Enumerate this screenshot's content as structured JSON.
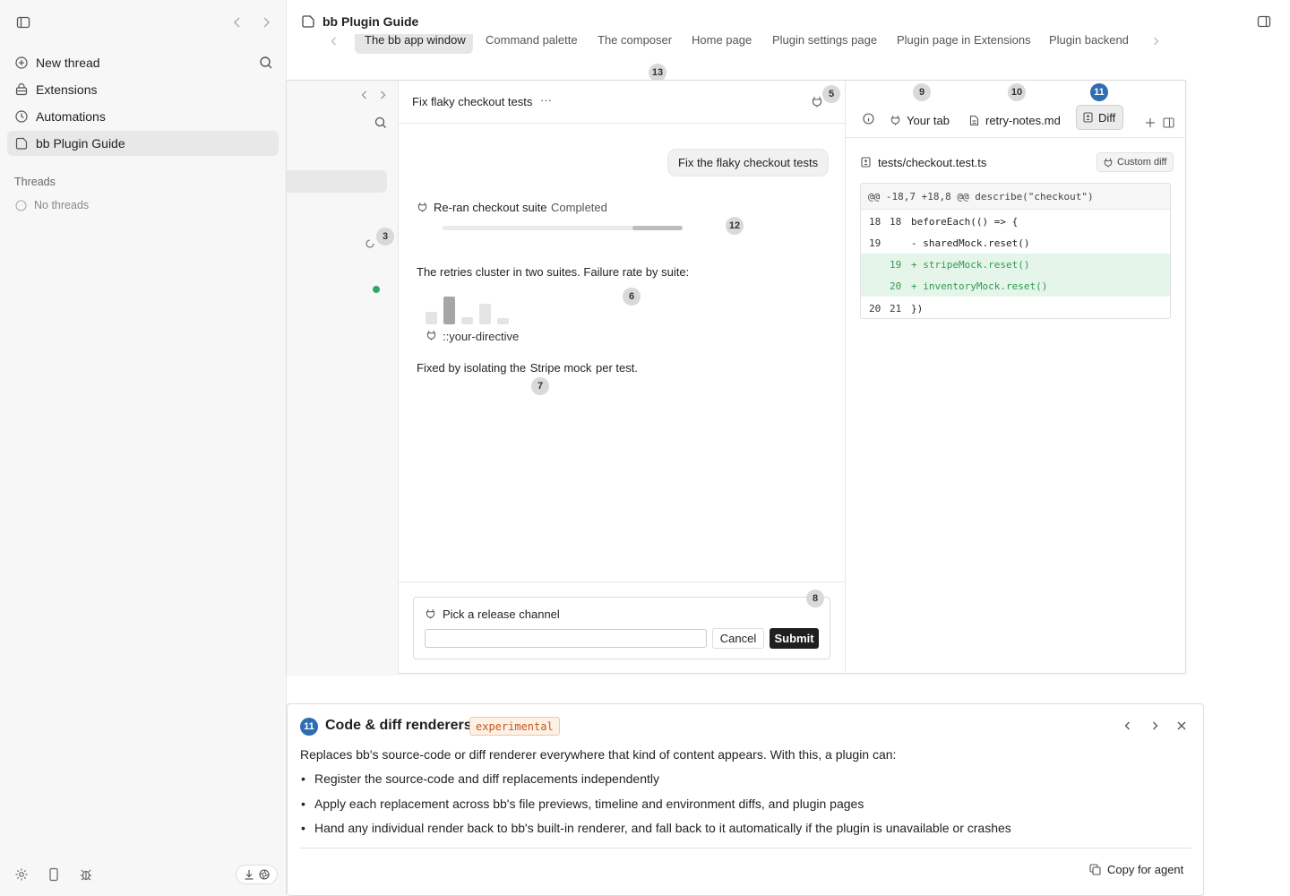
{
  "sidebar": {
    "items": [
      {
        "label": "New thread",
        "icon": "plus-circle-icon"
      },
      {
        "label": "Extensions",
        "icon": "extensions-icon"
      },
      {
        "label": "Automations",
        "icon": "clock-icon"
      },
      {
        "label": "bb Plugin Guide",
        "icon": "plugin-icon"
      }
    ],
    "threads_heading": "Threads",
    "no_threads": "No threads"
  },
  "header": {
    "title": "bb Plugin Guide",
    "tabs": [
      "The bb app window",
      "Command palette",
      "The composer",
      "Home page",
      "Plugin settings page",
      "Plugin page in Extensions",
      "Plugin backend"
    ]
  },
  "badges": {
    "b3": "3",
    "b5": "5",
    "b6": "6",
    "b7": "7",
    "b8": "8",
    "b9": "9",
    "b10": "10",
    "b11": "11",
    "b12": "12",
    "b13": "13"
  },
  "thread": {
    "title": "Fix flaky checkout tests",
    "more": "···",
    "user_message": "Fix the flaky checkout tests",
    "tool_label": "Re-ran checkout suite",
    "tool_status": "Completed",
    "progress": 0.79,
    "text1": "The retries cluster in two suites. Failure rate by suite:",
    "chart_bars": [
      0.45,
      1.0,
      0.27,
      0.73,
      0.23
    ],
    "directive": "::your-directive",
    "text2_pre": "Fixed by isolating the",
    "text2_hl": "Stripe mock",
    "text2_post": "per test."
  },
  "prompt": {
    "title": "Pick a release channel",
    "cancel": "Cancel",
    "submit": "Submit",
    "value": ""
  },
  "right_panel": {
    "tabs": [
      {
        "label": "Your tab",
        "icon": "plugin-icon"
      },
      {
        "label": "retry-notes.md",
        "icon": "note-icon"
      },
      {
        "label": "Diff",
        "icon": "diff-icon"
      }
    ],
    "file": "tests/checkout.test.ts",
    "custom_diff": "Custom diff",
    "hunk": "@@ -18,7 +18,8 @@ describe(\"checkout\")",
    "lines": [
      {
        "old": "18",
        "new": "18",
        "text": "beforeEach(() => {",
        "type": "ctx"
      },
      {
        "old": "19",
        "new": "",
        "text": "- sharedMock.reset()",
        "type": "del"
      },
      {
        "old": "",
        "new": "19",
        "text": "+ stripeMock.reset()",
        "type": "add"
      },
      {
        "old": "",
        "new": "20",
        "text": "+ inventoryMock.reset()",
        "type": "add"
      },
      {
        "old": "20",
        "new": "21",
        "text": "})",
        "type": "ctx"
      }
    ]
  },
  "card": {
    "badge": "11",
    "title": "Code & diff renderers",
    "tag": "experimental",
    "intro": "Replaces bb's source-code or diff renderer everywhere that kind of content appears. With this, a plugin can:",
    "bullets": [
      "Register the source-code and diff replacements independently",
      "Apply each replacement across bb's file previews, timeline and environment diffs, and plugin pages",
      "Hand any individual render back to bb's built-in renderer, and fall back to it automatically if the plugin is unavailable or crashes"
    ],
    "copy": "Copy for agent"
  }
}
